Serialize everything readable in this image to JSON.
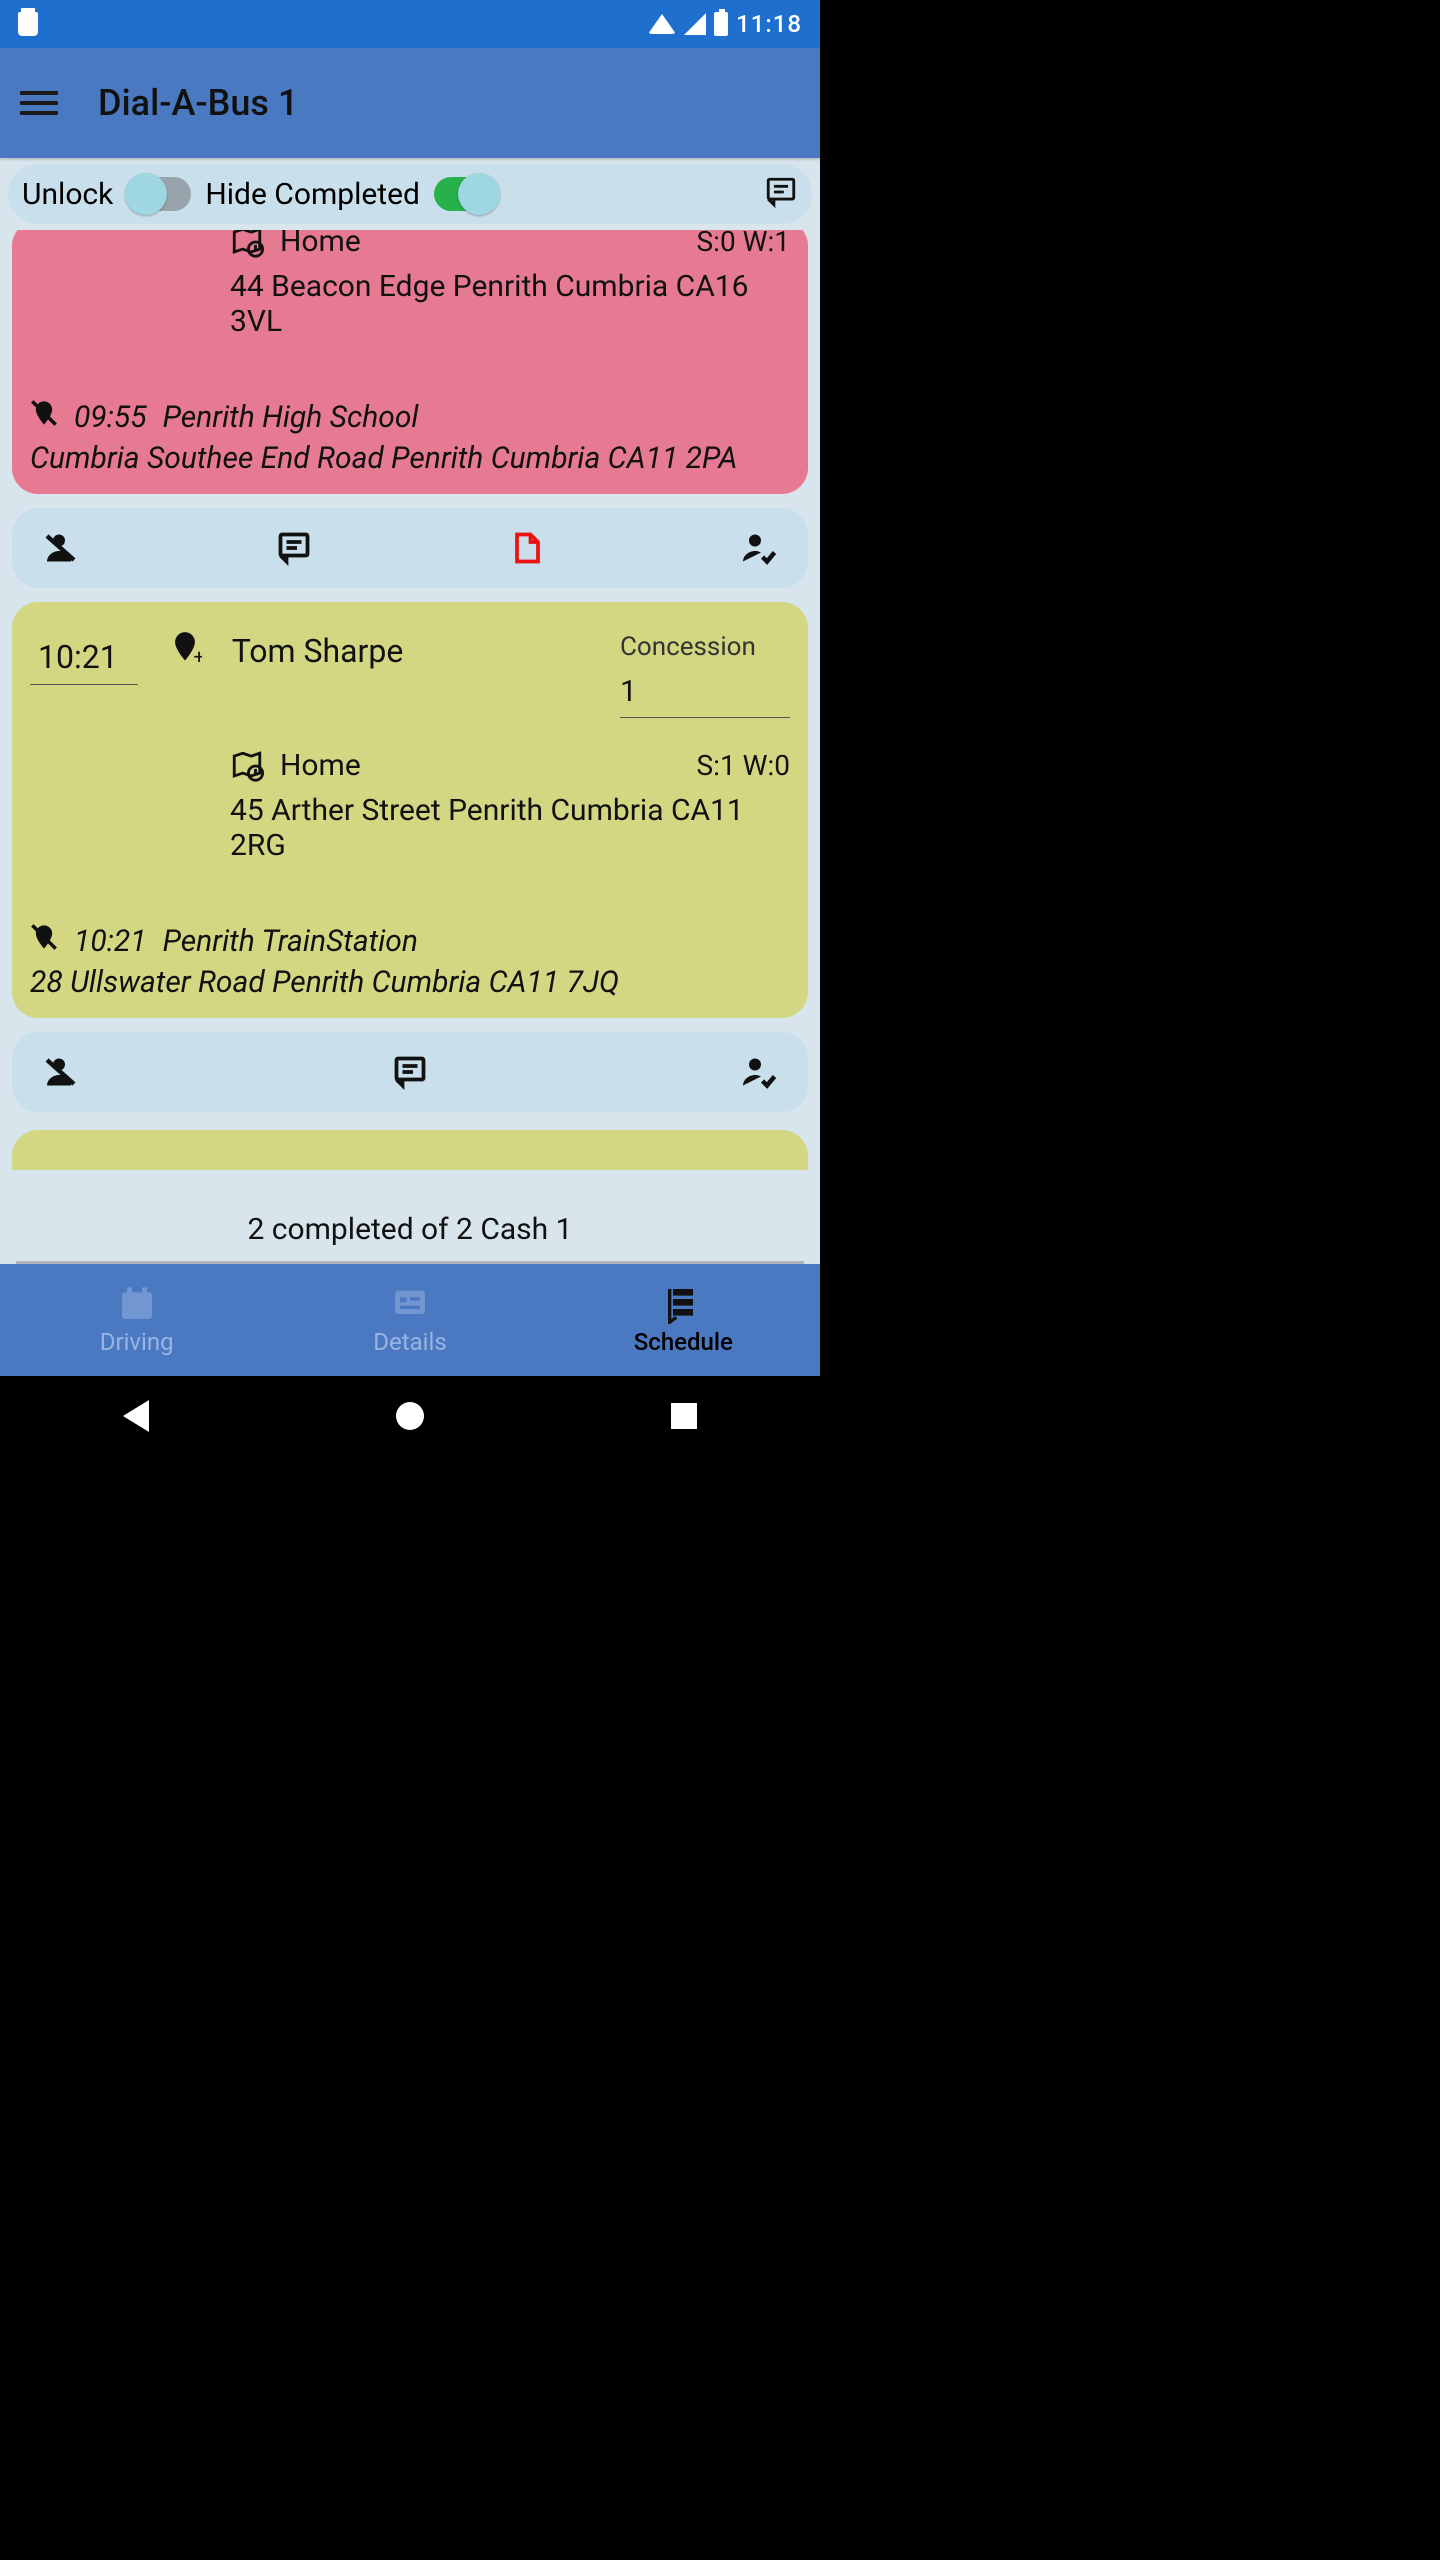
{
  "statusbar": {
    "time": "11:18"
  },
  "appbar": {
    "title": "Dial-A-Bus 1"
  },
  "togglebar": {
    "unlock_label": "Unlock",
    "hide_completed_label": "Hide Completed",
    "unlock_on": false,
    "hide_completed_on": true
  },
  "cards": [
    {
      "style": "pink",
      "origin_label": "Home",
      "origin_sw": "S:0 W:1",
      "origin_addr": "44 Beacon Edge  Penrith  Cumbria  CA16 3VL",
      "dest_time": "09:55",
      "dest_name": "Penrith High School",
      "dest_addr": "Cumbria  Southee End Road  Penrith  Cumbria  CA11 2PA"
    },
    {
      "style": "olive",
      "time": "10:21",
      "passenger": "Tom Sharpe",
      "concession_label": "Concession",
      "concession_value": "1",
      "origin_label": "Home",
      "origin_sw": "S:1 W:0",
      "origin_addr": "45 Arther Street  Penrith  Cumbria  CA11 2RG",
      "dest_time": "10:21",
      "dest_name": "Penrith TrainStation",
      "dest_addr": "28 Ullswater Road  Penrith  Cumbria  CA11 7JQ"
    }
  ],
  "summary": {
    "text": "2 completed of 2 Cash 1"
  },
  "tabs": {
    "driving": "Driving",
    "details": "Details",
    "schedule": "Schedule",
    "active": "schedule"
  }
}
